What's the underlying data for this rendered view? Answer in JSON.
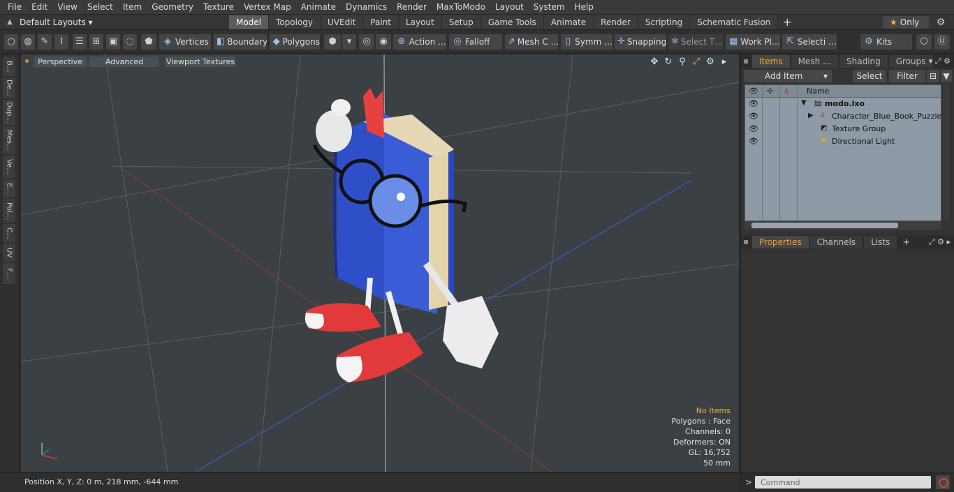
{
  "menu": [
    "File",
    "Edit",
    "View",
    "Select",
    "Item",
    "Geometry",
    "Texture",
    "Vertex Map",
    "Animate",
    "Dynamics",
    "Render",
    "MaxToModo",
    "Layout",
    "System",
    "Help"
  ],
  "layout": {
    "selector": "Default Layouts ▾",
    "only_label": "Only"
  },
  "tabs": [
    {
      "label": "Model",
      "active": true
    },
    {
      "label": "Topology"
    },
    {
      "label": "UVEdit"
    },
    {
      "label": "Paint"
    },
    {
      "label": "Layout"
    },
    {
      "label": "Setup"
    },
    {
      "label": "Game Tools"
    },
    {
      "label": "Animate"
    },
    {
      "label": "Render"
    },
    {
      "label": "Scripting"
    },
    {
      "label": "Schematic Fusion"
    }
  ],
  "toolbar": {
    "vertices": "Vertices",
    "boundary": "Boundary",
    "polygons": "Polygons",
    "action": "Action …",
    "falloff": "Falloff",
    "meshc": "Mesh C …",
    "symm": "Symm …",
    "snapping": "Snapping",
    "selectt": "Select T…",
    "workpl": "Work Pl…",
    "selecti": "Selecti …",
    "kits": "Kits"
  },
  "left_tabs": [
    "B…",
    "De…",
    "Dup…",
    "Mes…",
    "Ve…",
    "E…",
    "Pol…",
    "C…",
    "UV",
    "F…"
  ],
  "viewport": {
    "perspective": "Perspective",
    "advanced": "Advanced",
    "textures": "Viewport Textures",
    "stats": {
      "no_items": "No Items",
      "polygons": "Polygons : Face",
      "channels": "Channels: 0",
      "deformers": "Deformers: ON",
      "gl": "GL: 16,752",
      "scale": "50 mm"
    }
  },
  "status": {
    "position": "Position X, Y, Z:   0 m, 218 mm, -644 mm"
  },
  "items_panel": {
    "tabs": [
      {
        "label": "Items",
        "active": true
      },
      {
        "label": "Mesh …"
      },
      {
        "label": "Shading"
      },
      {
        "label": "Groups"
      }
    ],
    "add_item": "Add Item",
    "select": "Select",
    "filter": "Filter",
    "column_name": "Name",
    "rows": [
      {
        "label": "modo.lxo"
      },
      {
        "label": "Character_Blue_Book_Puzzle …"
      },
      {
        "label": "Texture Group"
      },
      {
        "label": "Directional Light"
      }
    ]
  },
  "props_panel": {
    "tabs": [
      {
        "label": "Properties",
        "active": true
      },
      {
        "label": "Channels"
      },
      {
        "label": "Lists"
      }
    ]
  },
  "command": {
    "placeholder": "Command"
  }
}
